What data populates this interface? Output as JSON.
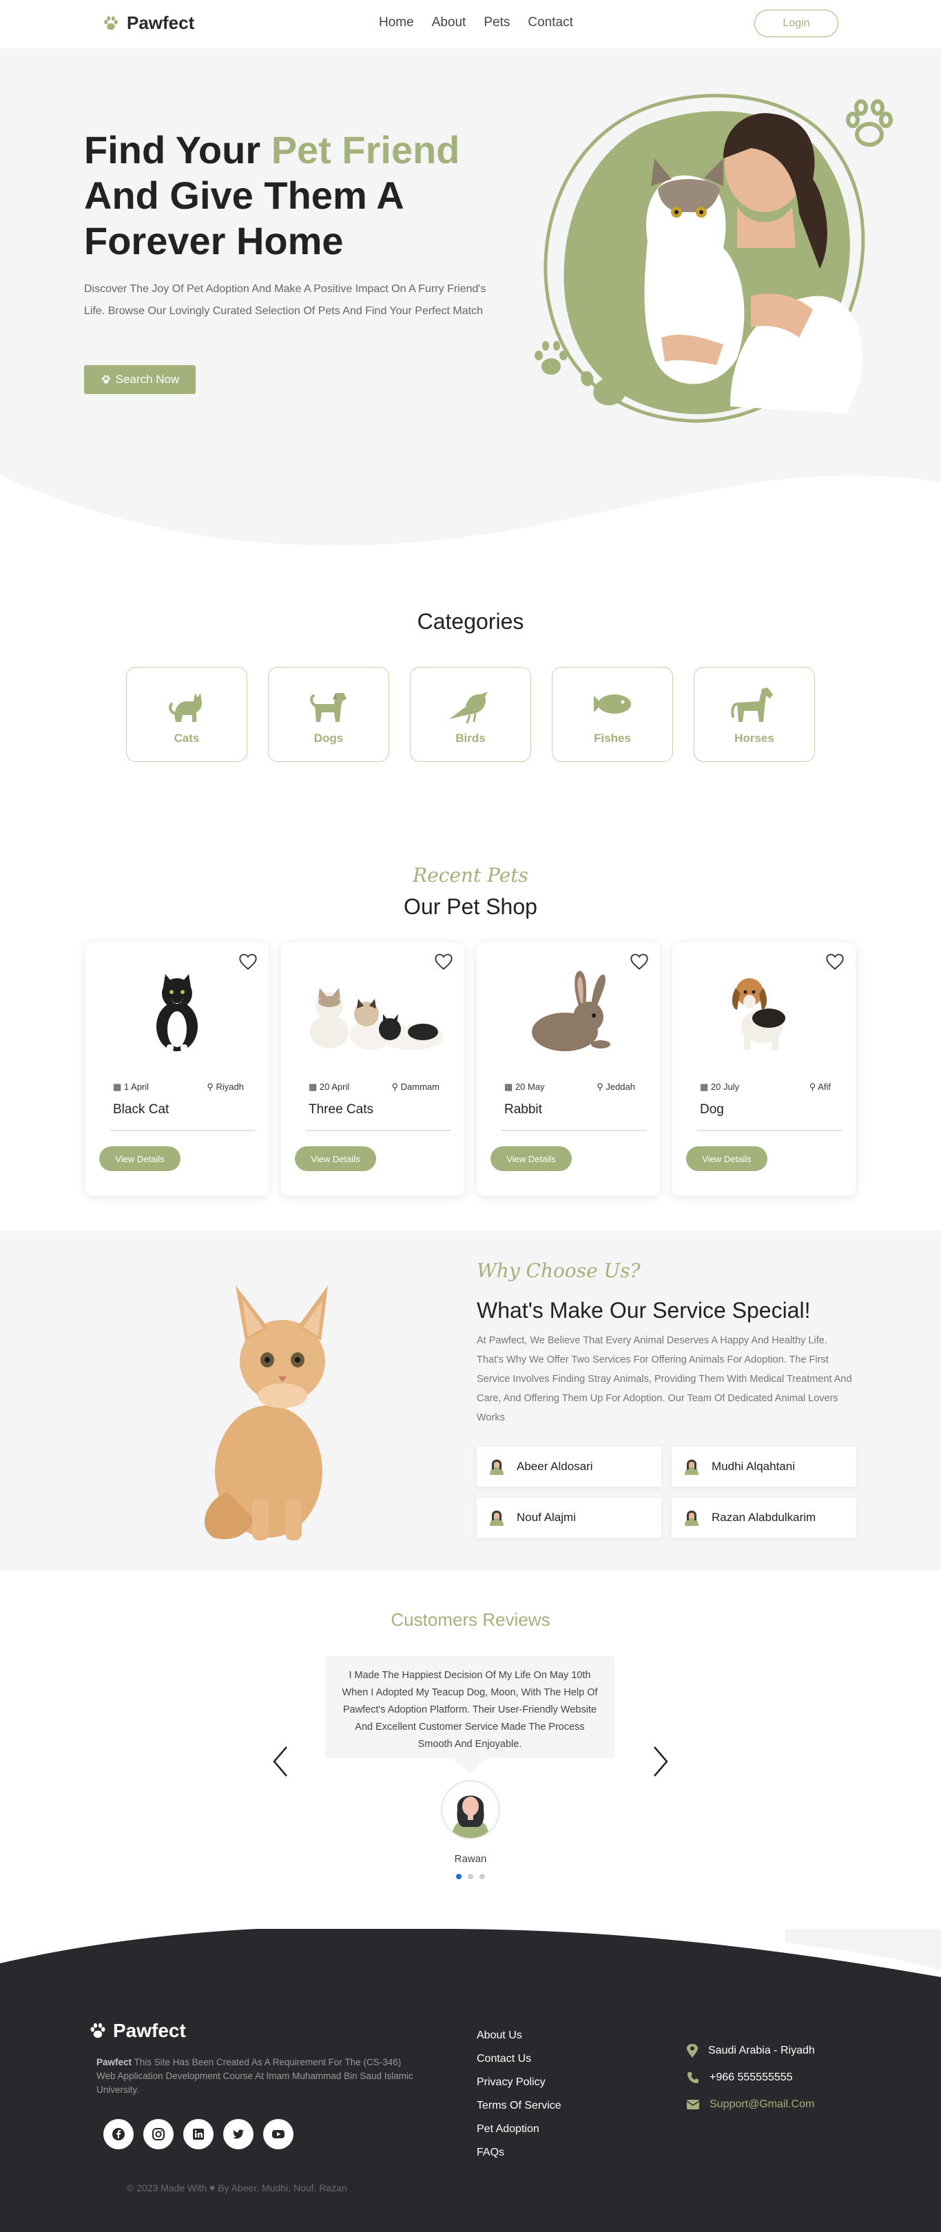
{
  "nav": {
    "brand": "Pawfect",
    "links": [
      "Home",
      "About",
      "Pets",
      "Contact"
    ],
    "login": "Login"
  },
  "hero": {
    "title_part1": "Find Your ",
    "title_accent": "Pet Friend",
    "title_part2": "And Give Them A Forever Home",
    "description": "Discover The Joy Of Pet Adoption And Make A Positive Impact On A Furry Friend's Life. Browse Our Lovingly Curated Selection Of Pets And Find Your Perfect Match",
    "cta": "Search Now"
  },
  "categories": {
    "title": "Categories",
    "items": [
      "Cats",
      "Dogs",
      "Birds",
      "Fishes",
      "Horses"
    ]
  },
  "shop": {
    "kicker": "Recent Pets",
    "title": "Our Pet Shop",
    "button": "View Details",
    "pets": [
      {
        "date": "1 April",
        "city": "Riyadh",
        "name": "Black Cat"
      },
      {
        "date": "20 April",
        "city": "Dammam",
        "name": "Three Cats"
      },
      {
        "date": "20 May",
        "city": "Jeddah",
        "name": "Rabbit"
      },
      {
        "date": "20 July",
        "city": "Afif",
        "name": "Dog"
      }
    ]
  },
  "why": {
    "kicker": "Why Choose Us?",
    "title": "What's Make Our Service Special!",
    "description": "At Pawfect, We Believe That Every Animal Deserves A Happy And Healthy Life. That's Why We Offer Two Services For Offering Animals For Adoption. The First Service Involves Finding Stray Animals, Providing Them With Medical Treatment And Care, And Offering Them Up For Adoption. Our Team Of Dedicated Animal Lovers Works",
    "team": [
      "Abeer Aldosari",
      "Mudhi Alqahtani",
      "Nouf Alajmi",
      "Razan Alabdulkarim"
    ]
  },
  "reviews": {
    "title": "Customers Reviews",
    "text": "I Made The Happiest Decision Of My Life On May 10th When I Adopted My Teacup Dog, Moon, With The Help Of Pawfect's Adoption Platform. Their User-Friendly Website And Excellent Customer Service Made The Process Smooth And Enjoyable.",
    "reviewer": "Rawan",
    "active_dot": 0,
    "dot_count": 3
  },
  "footer": {
    "brand": "Pawfect",
    "desc_bold": "Pawfect",
    "desc": " This Site Has Been Created As A Requirement For The (CS-346) Web Application Development Course At Imam Muhammad Bin Saud Islamic University.",
    "links": [
      "About Us",
      "Contact Us",
      "Privacy Policy",
      "Terms Of Service",
      "Pet Adoption",
      "FAQs"
    ],
    "location": "Saudi Arabia - Riyadh",
    "phone": "+966 555555555",
    "email": "Support@Gmail.Com",
    "copyright": "© 2023 Made With ♥ By Abeer, Mudhi, Nouf, Razan",
    "social": [
      "facebook-icon",
      "instagram-icon",
      "linkedin-icon",
      "twitter-icon",
      "youtube-icon"
    ]
  },
  "colors": {
    "accent": "#a3b27a",
    "footer_bg": "#28282d",
    "light_bg": "#f5f5f5"
  }
}
